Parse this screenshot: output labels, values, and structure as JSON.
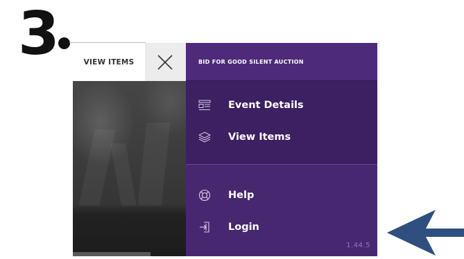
{
  "annotation": {
    "step": "3"
  },
  "tab": {
    "view_items_label": "VIEW ITEMS",
    "close_icon": "close-icon"
  },
  "menu": {
    "title": "BID FOR GOOD SILENT AUCTION",
    "items_top": [
      {
        "label": "Event Details",
        "icon": "event-details-icon"
      },
      {
        "label": "View Items",
        "icon": "layers-icon"
      }
    ],
    "items_bottom": [
      {
        "label": "Help",
        "icon": "lifebuoy-icon"
      },
      {
        "label": "Login",
        "icon": "login-icon"
      }
    ],
    "version": "1.44.5"
  },
  "colors": {
    "menu_bg": "#482771",
    "menu_section_bg": "#3c2062",
    "arrow": "#2f4f7f"
  }
}
